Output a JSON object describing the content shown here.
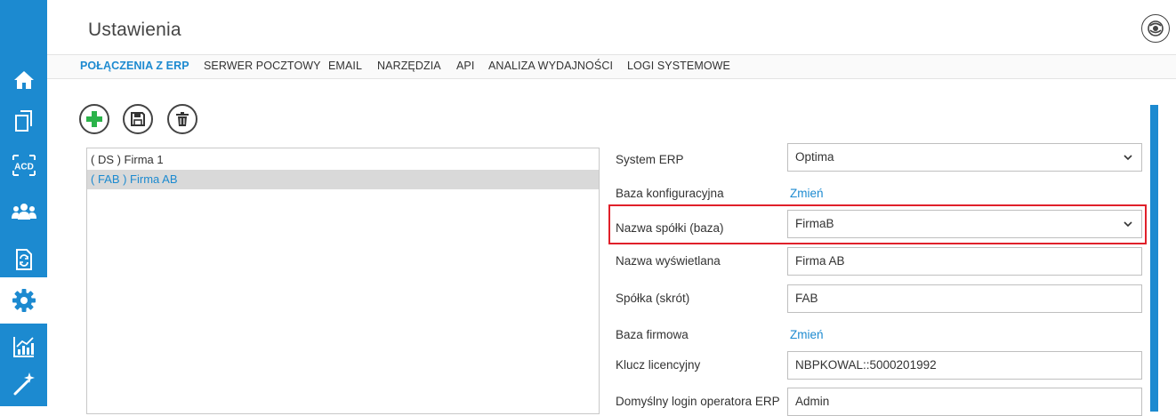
{
  "header": {
    "title": "Ustawienia"
  },
  "sidebar": {
    "items": [
      {
        "name": "home-icon"
      },
      {
        "name": "documents-icon"
      },
      {
        "name": "acd-icon"
      },
      {
        "name": "users-icon"
      },
      {
        "name": "document-refresh-icon"
      },
      {
        "name": "gear-icon",
        "active": true
      },
      {
        "name": "chart-icon"
      },
      {
        "name": "magic-wand-icon"
      }
    ],
    "acd_text": "ACD"
  },
  "tabs": [
    {
      "label": "POŁĄCZENIA Z ERP",
      "active": true
    },
    {
      "label": "SERWER POCZTOWY"
    },
    {
      "label": "EMAIL"
    },
    {
      "label": "NARZĘDZIA"
    },
    {
      "label": "API"
    },
    {
      "label": "ANALIZA WYDAJNOŚCI"
    },
    {
      "label": "LOGI SYSTEMOWE"
    }
  ],
  "toolbar": {
    "buttons": [
      {
        "icon": "plus-icon",
        "color": "#2bb34a"
      },
      {
        "icon": "save-icon"
      },
      {
        "icon": "trash-icon"
      }
    ]
  },
  "companies": [
    {
      "label": "( DS ) Firma 1",
      "selected": false
    },
    {
      "label": "( FAB ) Firma AB",
      "selected": true
    }
  ],
  "form": {
    "system_erp_label": "System ERP",
    "system_erp_value": "Optima",
    "config_db_label": "Baza konfiguracyjna",
    "config_db_link": "Zmień",
    "company_db_label": "Nazwa spółki (baza)",
    "company_db_value": "FirmaB",
    "display_name_label": "Nazwa wyświetlana",
    "display_name_value": "Firma AB",
    "short_label": "Spółka (skrót)",
    "short_value": "FAB",
    "company_base_label": "Baza firmowa",
    "company_base_link": "Zmień",
    "license_label": "Klucz licencyjny",
    "license_value": "NBPKOWAL::5000201992",
    "default_login_label": "Domyślny login operatora ERP",
    "default_login_value": "Admin"
  },
  "colors": {
    "accent": "#1c8ad0",
    "highlight": "#e0202a",
    "add_green": "#2bb34a"
  }
}
